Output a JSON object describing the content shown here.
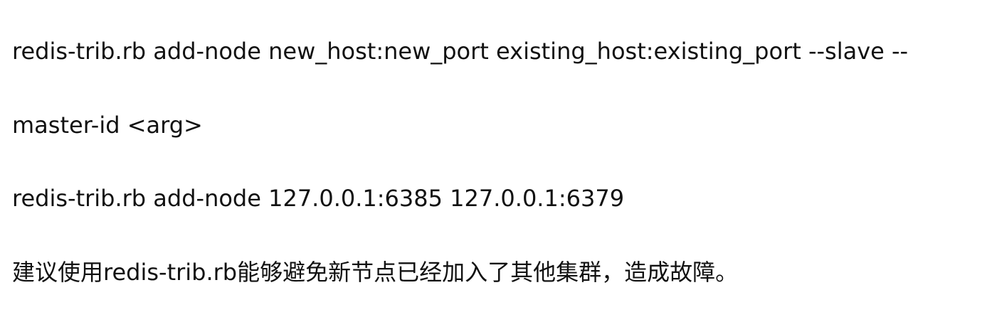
{
  "document": {
    "lines": [
      "redis-trib.rb add-node new_host:new_port existing_host:existing_port --slave --",
      "master-id <arg>",
      "redis-trib.rb add-node 127.0.0.1:6385 127.0.0.1:6379",
      "建议使用redis-trib.rb能够避免新节点已经加入了其他集群，造成故障。"
    ]
  }
}
